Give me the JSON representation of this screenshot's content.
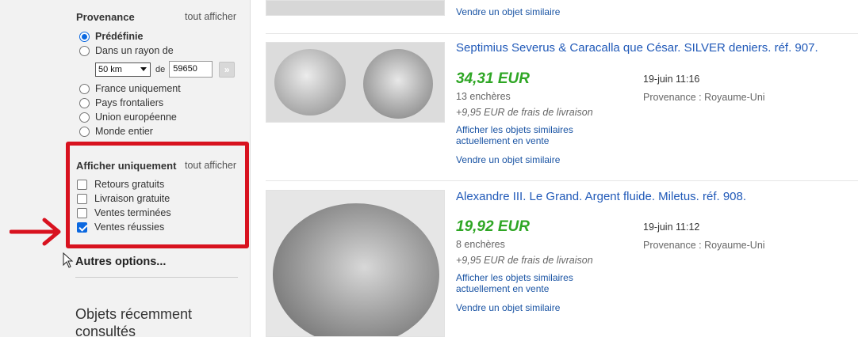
{
  "sidebar": {
    "provenance": {
      "title": "Provenance",
      "see_all": "tout afficher",
      "options": [
        {
          "label": "Prédéfinie",
          "selected": true
        },
        {
          "label": "Dans un rayon de",
          "selected": false
        },
        {
          "label": "France uniquement",
          "selected": false
        },
        {
          "label": "Pays frontaliers",
          "selected": false
        },
        {
          "label": "Union européenne",
          "selected": false
        },
        {
          "label": "Monde entier",
          "selected": false
        }
      ],
      "radius": {
        "value": "50 km",
        "connector": "de",
        "zip": "59650",
        "go_icon": "double-chevron-right-icon"
      }
    },
    "show_only": {
      "title": "Afficher uniquement",
      "see_all": "tout afficher",
      "options": [
        {
          "label": "Retours gratuits",
          "checked": false
        },
        {
          "label": "Livraison gratuite",
          "checked": false
        },
        {
          "label": "Ventes terminées",
          "checked": false
        },
        {
          "label": "Ventes réussies",
          "checked": true
        }
      ]
    },
    "more_options": "Autres options...",
    "recently_viewed": "Objets récemment consultés"
  },
  "annotation": {
    "box_color": "#d8121f",
    "arrow_color": "#d8121f"
  },
  "results": {
    "top_similar_link": "Vendre un objet similaire",
    "items": [
      {
        "title": "Septimius Severus & Caracalla que César. SILVER deniers. réf. 907.",
        "price": "34,31 EUR",
        "bids": "13 enchères",
        "shipping": "+9,95 EUR de frais de livraison",
        "date": "19-juin 11:16",
        "origin": "Provenance : Royaume-Uni",
        "similar_link": "Afficher les objets similaires actuellement en vente",
        "sell_link": "Vendre un objet similaire"
      },
      {
        "title": "Alexandre III. Le Grand. Argent fluide. Miletus. réf. 908.",
        "price": "19,92 EUR",
        "bids": "8 enchères",
        "shipping": "+9,95 EUR de frais de livraison",
        "date": "19-juin 11:12",
        "origin": "Provenance : Royaume-Uni",
        "similar_link": "Afficher les objets similaires actuellement en vente",
        "sell_link": "Vendre un objet similaire"
      }
    ]
  },
  "colors": {
    "price": "#2ea624",
    "link": "#1a54a4",
    "title": "#2059b8",
    "accent": "#0b68e0"
  }
}
